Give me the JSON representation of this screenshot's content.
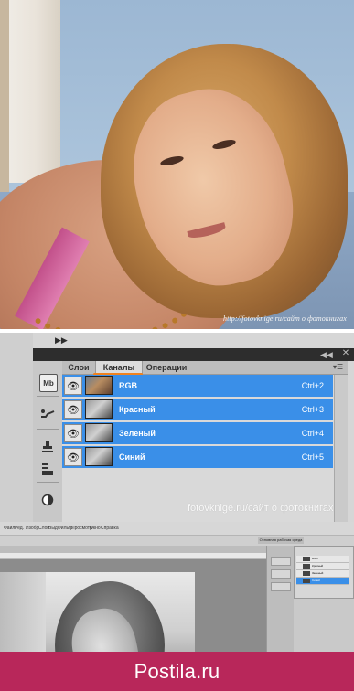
{
  "photo": {
    "caption": "http://fotovknige.ru/сайт о фотокнигах"
  },
  "panels": {
    "tabs": [
      "Слои",
      "Каналы",
      "Операции"
    ],
    "channels": [
      {
        "name": "RGB",
        "shortcut": "Ctrl+2",
        "thumb": "rgb"
      },
      {
        "name": "Красный",
        "shortcut": "Ctrl+3",
        "thumb": "gray"
      },
      {
        "name": "Зеленый",
        "shortcut": "Ctrl+4",
        "thumb": "gray"
      },
      {
        "name": "Синий",
        "shortcut": "Ctrl+5",
        "thumb": "gray"
      }
    ],
    "toolbar_icons": [
      "mini-bridge-icon",
      "brush-presets-icon",
      "clone-source-icon",
      "tool-presets-icon",
      "mask-icon"
    ],
    "toolbar_mb_label": "Mb",
    "watermark": "fotovknige.ru/сайт о фотокнигах",
    "accent": "#3a8fe8",
    "tab_underline": "#f0821e"
  },
  "workspace": {
    "menubar": [
      "Файл",
      "Ред.",
      "Изобр.",
      "Слои",
      "Выд.",
      "Фильтр",
      "Просмотр",
      "Окно",
      "Справка"
    ],
    "workspace_button": "Основная рабочая среда",
    "mini_channels": [
      "RGB",
      "Красный",
      "Зеленый",
      "Синий"
    ]
  },
  "footer": {
    "brand": "Postila.ru",
    "color": "#b8275a"
  }
}
